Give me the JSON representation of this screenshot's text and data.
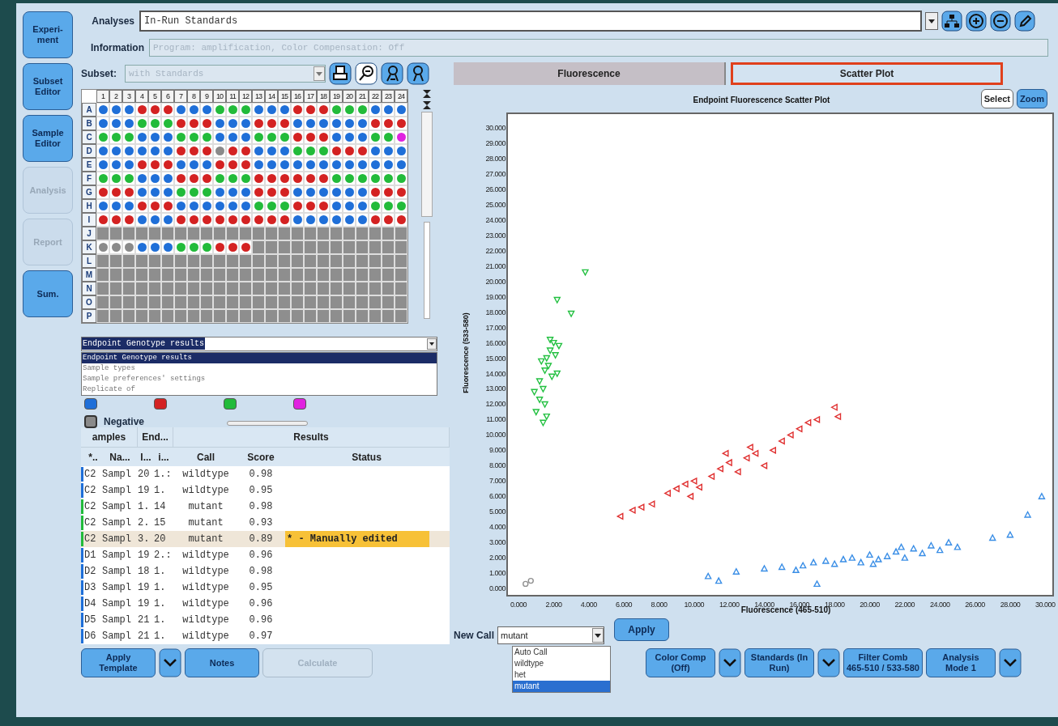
{
  "nav": [
    {
      "label": "Experi-\nment",
      "disabled": false
    },
    {
      "label": "Subset\nEditor",
      "disabled": false
    },
    {
      "label": "Sample\nEditor",
      "disabled": false
    },
    {
      "label": "Analysis",
      "disabled": true
    },
    {
      "label": "Report",
      "disabled": true
    },
    {
      "label": "Sum.",
      "disabled": false
    }
  ],
  "analyses": {
    "label": "Analyses",
    "value": "In-Run Standards"
  },
  "information": {
    "label": "Information",
    "value": "Program: amplification, Color Compensation: Off",
    "disabled": true
  },
  "subset": {
    "label": "Subset:",
    "value": "with Standards",
    "disabled": true
  },
  "plate": {
    "columns": [
      "1",
      "2",
      "3",
      "4",
      "5",
      "6",
      "7",
      "8",
      "9",
      "10",
      "11",
      "12",
      "13",
      "14",
      "15",
      "16",
      "17",
      "18",
      "19",
      "20",
      "21",
      "22",
      "23",
      "24"
    ],
    "rows": [
      {
        "label": "A",
        "wells": [
          {
            "color": "#1f6fd8"
          },
          {
            "color": "#1f6fd8"
          },
          {
            "color": "#1f6fd8"
          },
          {
            "color": "#d42222"
          },
          {
            "color": "#d42222"
          },
          {
            "color": "#d42222"
          },
          {
            "color": "#1f6fd8"
          },
          {
            "color": "#1f6fd8"
          },
          {
            "color": "#1f6fd8"
          },
          {
            "color": "#22bb3a"
          },
          {
            "color": "#22bb3a"
          },
          {
            "color": "#22bb3a"
          },
          {
            "color": "#1f6fd8"
          },
          {
            "color": "#1f6fd8"
          },
          {
            "color": "#1f6fd8"
          },
          {
            "color": "#d42222"
          },
          {
            "color": "#d42222"
          },
          {
            "color": "#d42222"
          },
          {
            "color": "#22bb3a"
          },
          {
            "color": "#22bb3a"
          },
          {
            "color": "#22bb3a"
          },
          {
            "color": "#1f6fd8"
          },
          {
            "color": "#1f6fd8"
          },
          {
            "color": "#1f6fd8"
          }
        ]
      },
      {
        "label": "B",
        "wells": [
          {
            "color": "#1f6fd8"
          },
          {
            "color": "#1f6fd8"
          },
          {
            "color": "#1f6fd8"
          },
          {
            "color": "#22bb3a"
          },
          {
            "color": "#22bb3a"
          },
          {
            "color": "#22bb3a"
          },
          {
            "color": "#d42222"
          },
          {
            "color": "#d42222"
          },
          {
            "color": "#d42222"
          },
          {
            "color": "#1f6fd8"
          },
          {
            "color": "#1f6fd8"
          },
          {
            "color": "#1f6fd8"
          },
          {
            "color": "#d42222"
          },
          {
            "color": "#d42222"
          },
          {
            "color": "#d42222"
          },
          {
            "color": "#1f6fd8"
          },
          {
            "color": "#1f6fd8"
          },
          {
            "color": "#1f6fd8"
          },
          {
            "color": "#1f6fd8"
          },
          {
            "color": "#1f6fd8"
          },
          {
            "color": "#1f6fd8"
          },
          {
            "color": "#d42222"
          },
          {
            "color": "#d42222"
          },
          {
            "color": "#d42222"
          }
        ]
      },
      {
        "label": "C",
        "wells": [
          {
            "color": "#22bb3a"
          },
          {
            "color": "#22bb3a"
          },
          {
            "color": "#22bb3a"
          },
          {
            "color": "#1f6fd8"
          },
          {
            "color": "#1f6fd8"
          },
          {
            "color": "#1f6fd8"
          },
          {
            "color": "#22bb3a"
          },
          {
            "color": "#22bb3a"
          },
          {
            "color": "#22bb3a"
          },
          {
            "color": "#1f6fd8"
          },
          {
            "color": "#1f6fd8"
          },
          {
            "color": "#1f6fd8"
          },
          {
            "color": "#22bb3a"
          },
          {
            "color": "#22bb3a"
          },
          {
            "color": "#22bb3a"
          },
          {
            "color": "#d42222"
          },
          {
            "color": "#d42222"
          },
          {
            "color": "#d42222"
          },
          {
            "color": "#1f6fd8"
          },
          {
            "color": "#1f6fd8"
          },
          {
            "color": "#1f6fd8"
          },
          {
            "color": "#22bb3a"
          },
          {
            "color": "#22bb3a"
          },
          {
            "color": "#e022e0"
          }
        ]
      },
      {
        "label": "D",
        "wells": [
          {
            "color": "#1f6fd8"
          },
          {
            "color": "#1f6fd8"
          },
          {
            "color": "#1f6fd8"
          },
          {
            "color": "#1f6fd8"
          },
          {
            "color": "#1f6fd8"
          },
          {
            "color": "#1f6fd8"
          },
          {
            "color": "#d42222"
          },
          {
            "color": "#d42222"
          },
          {
            "color": "#d42222"
          },
          {
            "color": "#8a8a8a"
          },
          {
            "color": "#d42222"
          },
          {
            "color": "#d42222"
          },
          {
            "color": "#1f6fd8"
          },
          {
            "color": "#1f6fd8"
          },
          {
            "color": "#1f6fd8"
          },
          {
            "color": "#22bb3a"
          },
          {
            "color": "#22bb3a"
          },
          {
            "color": "#22bb3a"
          },
          {
            "color": "#d42222"
          },
          {
            "color": "#d42222"
          },
          {
            "color": "#d42222"
          },
          {
            "color": "#1f6fd8"
          },
          {
            "color": "#1f6fd8"
          },
          {
            "color": "#1f6fd8"
          }
        ]
      },
      {
        "label": "E",
        "wells": [
          {
            "color": "#1f6fd8"
          },
          {
            "color": "#1f6fd8"
          },
          {
            "color": "#1f6fd8"
          },
          {
            "color": "#d42222"
          },
          {
            "color": "#d42222"
          },
          {
            "color": "#d42222"
          },
          {
            "color": "#1f6fd8"
          },
          {
            "color": "#1f6fd8"
          },
          {
            "color": "#1f6fd8"
          },
          {
            "color": "#d42222"
          },
          {
            "color": "#d42222"
          },
          {
            "color": "#d42222"
          },
          {
            "color": "#1f6fd8"
          },
          {
            "color": "#1f6fd8"
          },
          {
            "color": "#1f6fd8"
          },
          {
            "color": "#1f6fd8"
          },
          {
            "color": "#1f6fd8"
          },
          {
            "color": "#1f6fd8"
          },
          {
            "color": "#1f6fd8"
          },
          {
            "color": "#1f6fd8"
          },
          {
            "color": "#1f6fd8"
          },
          {
            "color": "#1f6fd8"
          },
          {
            "color": "#1f6fd8"
          },
          {
            "color": "#1f6fd8"
          }
        ]
      },
      {
        "label": "F",
        "wells": [
          {
            "color": "#22bb3a"
          },
          {
            "color": "#22bb3a"
          },
          {
            "color": "#22bb3a"
          },
          {
            "color": "#1f6fd8"
          },
          {
            "color": "#1f6fd8"
          },
          {
            "color": "#1f6fd8"
          },
          {
            "color": "#d42222"
          },
          {
            "color": "#d42222"
          },
          {
            "color": "#d42222"
          },
          {
            "color": "#22bb3a"
          },
          {
            "color": "#22bb3a"
          },
          {
            "color": "#22bb3a"
          },
          {
            "color": "#d42222"
          },
          {
            "color": "#d42222"
          },
          {
            "color": "#d42222"
          },
          {
            "color": "#d42222"
          },
          {
            "color": "#d42222"
          },
          {
            "color": "#d42222"
          },
          {
            "color": "#22bb3a"
          },
          {
            "color": "#22bb3a"
          },
          {
            "color": "#22bb3a"
          },
          {
            "color": "#22bb3a"
          },
          {
            "color": "#22bb3a"
          },
          {
            "color": "#22bb3a"
          }
        ]
      },
      {
        "label": "G",
        "wells": [
          {
            "color": "#d42222"
          },
          {
            "color": "#d42222"
          },
          {
            "color": "#d42222"
          },
          {
            "color": "#1f6fd8"
          },
          {
            "color": "#1f6fd8"
          },
          {
            "color": "#1f6fd8"
          },
          {
            "color": "#22bb3a"
          },
          {
            "color": "#22bb3a"
          },
          {
            "color": "#22bb3a"
          },
          {
            "color": "#1f6fd8"
          },
          {
            "color": "#1f6fd8"
          },
          {
            "color": "#1f6fd8"
          },
          {
            "color": "#d42222"
          },
          {
            "color": "#d42222"
          },
          {
            "color": "#d42222"
          },
          {
            "color": "#1f6fd8"
          },
          {
            "color": "#1f6fd8"
          },
          {
            "color": "#1f6fd8"
          },
          {
            "color": "#1f6fd8"
          },
          {
            "color": "#1f6fd8"
          },
          {
            "color": "#1f6fd8"
          },
          {
            "color": "#d42222"
          },
          {
            "color": "#d42222"
          },
          {
            "color": "#d42222"
          }
        ]
      },
      {
        "label": "H",
        "wells": [
          {
            "color": "#1f6fd8"
          },
          {
            "color": "#1f6fd8"
          },
          {
            "color": "#1f6fd8"
          },
          {
            "color": "#d42222"
          },
          {
            "color": "#d42222"
          },
          {
            "color": "#d42222"
          },
          {
            "color": "#1f6fd8"
          },
          {
            "color": "#1f6fd8"
          },
          {
            "color": "#1f6fd8"
          },
          {
            "color": "#1f6fd8"
          },
          {
            "color": "#1f6fd8"
          },
          {
            "color": "#1f6fd8"
          },
          {
            "color": "#22bb3a"
          },
          {
            "color": "#22bb3a"
          },
          {
            "color": "#22bb3a"
          },
          {
            "color": "#d42222"
          },
          {
            "color": "#d42222"
          },
          {
            "color": "#d42222"
          },
          {
            "color": "#1f6fd8"
          },
          {
            "color": "#1f6fd8"
          },
          {
            "color": "#1f6fd8"
          },
          {
            "color": "#22bb3a"
          },
          {
            "color": "#22bb3a"
          },
          {
            "color": "#22bb3a"
          }
        ]
      },
      {
        "label": "I",
        "wells": [
          {
            "color": "#d42222"
          },
          {
            "color": "#d42222"
          },
          {
            "color": "#d42222"
          },
          {
            "color": "#1f6fd8"
          },
          {
            "color": "#1f6fd8"
          },
          {
            "color": "#1f6fd8"
          },
          {
            "color": "#d42222"
          },
          {
            "color": "#d42222"
          },
          {
            "color": "#d42222"
          },
          {
            "color": "#d42222"
          },
          {
            "color": "#d42222"
          },
          {
            "color": "#d42222"
          },
          {
            "color": "#d42222"
          },
          {
            "color": "#d42222"
          },
          {
            "color": "#d42222"
          },
          {
            "color": "#1f6fd8"
          },
          {
            "color": "#1f6fd8"
          },
          {
            "color": "#1f6fd8"
          },
          {
            "color": "#1f6fd8"
          },
          {
            "color": "#1f6fd8"
          },
          {
            "color": "#1f6fd8"
          },
          {
            "color": "#d42222"
          },
          {
            "color": "#d42222"
          },
          {
            "color": "#d42222"
          }
        ]
      },
      {
        "label": "J"
      },
      {
        "label": "K",
        "wells": [
          {
            "color": "#8a8a8a"
          },
          {
            "color": "#8a8a8a"
          },
          {
            "color": "#8a8a8a"
          },
          {
            "color": "#1f6fd8"
          },
          {
            "color": "#1f6fd8"
          },
          {
            "color": "#1f6fd8"
          },
          {
            "color": "#22bb3a"
          },
          {
            "color": "#22bb3a"
          },
          {
            "color": "#22bb3a"
          },
          {
            "color": "#d42222"
          },
          {
            "color": "#d42222"
          },
          {
            "color": "#d42222"
          }
        ]
      },
      {
        "label": "L"
      },
      {
        "label": "M"
      },
      {
        "label": "N"
      },
      {
        "label": "O"
      },
      {
        "label": "P"
      }
    ]
  },
  "view_select": {
    "value": "Endpoint Genotype results",
    "options": [
      {
        "label": "Endpoint Genotype results",
        "selected": true
      },
      {
        "label": "Sample types",
        "selected": false
      },
      {
        "label": "Sample preferences' settings",
        "selected": false
      },
      {
        "label": "Replicate of",
        "selected": false
      }
    ]
  },
  "legend": [
    {
      "color": "#1f6fd8"
    },
    {
      "color": "#d42222"
    },
    {
      "color": "#22bb3a"
    },
    {
      "color": "#e022e0"
    },
    {
      "color": "#8a8a8a",
      "label": "Negative"
    }
  ],
  "table": {
    "groups": [
      "amples",
      "End...",
      "Results"
    ],
    "columns": [
      "*..",
      "Na...",
      "I...",
      "i...",
      "Call",
      "Score",
      "Status"
    ],
    "rows": [
      {
        "color": "#1f6fd8",
        "selected": false,
        "cells": [
          "C2",
          "Sampl",
          "20",
          "1.:",
          "wildtype",
          "0.98",
          ""
        ]
      },
      {
        "color": "#1f6fd8",
        "selected": false,
        "cells": [
          "C2",
          "Sampl",
          "19",
          "1.",
          "wildtype",
          "0.95",
          ""
        ]
      },
      {
        "color": "#22bb3a",
        "selected": false,
        "cells": [
          "C2",
          "Sampl",
          "1.",
          "14",
          "mutant",
          "0.98",
          ""
        ]
      },
      {
        "color": "#22bb3a",
        "selected": false,
        "cells": [
          "C2",
          "Sampl",
          "2.",
          "15",
          "mutant",
          "0.93",
          ""
        ]
      },
      {
        "color": "#22bb3a",
        "selected": true,
        "cells": [
          "C2",
          "Sampl",
          "3.",
          "20",
          "mutant",
          "0.89",
          "* - Manually edited"
        ]
      },
      {
        "color": "#1f6fd8",
        "selected": false,
        "cells": [
          "D1",
          "Sampl",
          "19",
          "2.:",
          "wildtype",
          "0.96",
          ""
        ]
      },
      {
        "color": "#1f6fd8",
        "selected": false,
        "cells": [
          "D2",
          "Sampl",
          "18",
          "1.",
          "wildtype",
          "0.98",
          ""
        ]
      },
      {
        "color": "#1f6fd8",
        "selected": false,
        "cells": [
          "D3",
          "Sampl",
          "19",
          "1.",
          "wildtype",
          "0.95",
          ""
        ]
      },
      {
        "color": "#1f6fd8",
        "selected": false,
        "cells": [
          "D4",
          "Sampl",
          "19",
          "1.",
          "wildtype",
          "0.96",
          ""
        ]
      },
      {
        "color": "#1f6fd8",
        "selected": false,
        "cells": [
          "D5",
          "Sampl",
          "21",
          "1.",
          "wildtype",
          "0.96",
          ""
        ]
      },
      {
        "color": "#1f6fd8",
        "selected": false,
        "cells": [
          "D6",
          "Sampl",
          "21",
          "1.",
          "wildtype",
          "0.97",
          ""
        ]
      }
    ]
  },
  "tabs": [
    {
      "label": "Fluorescence",
      "selected": false
    },
    {
      "label": "Scatter Plot",
      "selected": true
    }
  ],
  "plot_buttons": [
    {
      "label": "Select",
      "selected": false
    },
    {
      "label": "Zoom",
      "selected": true
    }
  ],
  "chart_data": {
    "type": "scatter",
    "title": "Endpoint Fluorescence Scatter Plot",
    "xlabel": "Fluorescence (465-510)",
    "ylabel": "Fluorescence (533-580)",
    "xlim": [
      -0.65,
      30.45
    ],
    "ylim": [
      -0.47,
      30.95
    ],
    "xticks": [
      {
        "value": 0,
        "label": "0.000"
      },
      {
        "value": 2,
        "label": "2.000"
      },
      {
        "value": 4,
        "label": "4.000"
      },
      {
        "value": 6,
        "label": "6.000"
      },
      {
        "value": 8,
        "label": "8.000"
      },
      {
        "value": 10,
        "label": "10.000"
      },
      {
        "value": 12,
        "label": "12.000"
      },
      {
        "value": 14,
        "label": "14.000"
      },
      {
        "value": 16,
        "label": "16.000"
      },
      {
        "value": 18,
        "label": "18.000"
      },
      {
        "value": 20,
        "label": "20.000"
      },
      {
        "value": 22,
        "label": "22.000"
      },
      {
        "value": 24,
        "label": "24.000"
      },
      {
        "value": 26,
        "label": "26.000"
      },
      {
        "value": 28,
        "label": "28.000"
      },
      {
        "value": 30,
        "label": "30.000"
      }
    ],
    "yticks": [
      {
        "value": 0,
        "label": "0.000"
      },
      {
        "value": 1,
        "label": "1.000"
      },
      {
        "value": 2,
        "label": "2.000"
      },
      {
        "value": 3,
        "label": "3.000"
      },
      {
        "value": 4,
        "label": "4.000"
      },
      {
        "value": 5,
        "label": "5.000"
      },
      {
        "value": 6,
        "label": "6.000"
      },
      {
        "value": 7,
        "label": "7.000"
      },
      {
        "value": 8,
        "label": "8.000"
      },
      {
        "value": 9,
        "label": "9.000"
      },
      {
        "value": 10,
        "label": "10.000"
      },
      {
        "value": 11,
        "label": "11.000"
      },
      {
        "value": 12,
        "label": "12.000"
      },
      {
        "value": 13,
        "label": "13.000"
      },
      {
        "value": 14,
        "label": "14.000"
      },
      {
        "value": 15,
        "label": "15.000"
      },
      {
        "value": 16,
        "label": "16.000"
      },
      {
        "value": 17,
        "label": "17.000"
      },
      {
        "value": 18,
        "label": "18.000"
      },
      {
        "value": 19,
        "label": "19.000"
      },
      {
        "value": 20,
        "label": "20.000"
      },
      {
        "value": 21,
        "label": "21.000"
      },
      {
        "value": 22,
        "label": "22.000"
      },
      {
        "value": 23,
        "label": "23.000"
      },
      {
        "value": 24,
        "label": "24.000"
      },
      {
        "value": 25,
        "label": "25.000"
      },
      {
        "value": 26,
        "label": "26.000"
      },
      {
        "value": 27,
        "label": "27.000"
      },
      {
        "value": 28,
        "label": "28.000"
      },
      {
        "value": 29,
        "label": "29.000"
      },
      {
        "value": 30,
        "label": "30.000"
      }
    ],
    "series": [
      {
        "color": "#22c040",
        "marker": "triangle",
        "x": [
          1.0,
          1.2,
          1.4,
          1.5,
          1.6,
          1.8,
          2.0,
          1.3,
          1.7,
          1.9,
          2.1,
          1.5,
          1.2,
          2.3,
          1.6,
          0.9,
          2.2,
          1.8,
          2.2,
          3.0,
          3.8,
          1.4
        ],
        "values": [
          11.5,
          12.3,
          13.0,
          14.2,
          15.0,
          15.5,
          16.0,
          14.8,
          14.5,
          13.8,
          15.2,
          12.0,
          13.5,
          15.8,
          11.2,
          12.8,
          14.0,
          16.2,
          18.8,
          17.9,
          20.6,
          10.8
        ]
      },
      {
        "color": "#e03030",
        "marker": "triangle",
        "x": [
          5.8,
          6.5,
          7.0,
          7.6,
          8.5,
          9.0,
          9.5,
          10.0,
          10.3,
          11.0,
          11.5,
          12.0,
          12.5,
          13.0,
          13.5,
          14.0,
          14.5,
          15.0,
          15.5,
          16.0,
          16.5,
          17.0,
          18.0,
          18.2,
          9.8,
          11.8,
          13.2
        ],
        "values": [
          4.7,
          5.1,
          5.3,
          5.5,
          6.2,
          6.5,
          6.8,
          7.0,
          6.6,
          7.3,
          7.8,
          8.2,
          7.6,
          8.5,
          8.8,
          8.0,
          9.0,
          9.6,
          10.0,
          10.4,
          10.8,
          11.0,
          11.8,
          11.2,
          6.0,
          8.8,
          9.2
        ]
      },
      {
        "color": "#3a8ee6",
        "marker": "triangle",
        "x": [
          10.8,
          11.4,
          12.4,
          14.0,
          15.0,
          15.8,
          16.2,
          16.8,
          17.0,
          17.5,
          18.0,
          18.5,
          19.0,
          19.5,
          20.0,
          20.5,
          21.0,
          21.5,
          22.0,
          22.5,
          23.0,
          23.5,
          24.0,
          24.5,
          25.0,
          27.0,
          28.0,
          29.0,
          29.8,
          20.2,
          21.8
        ],
        "values": [
          0.8,
          0.5,
          1.1,
          1.3,
          1.4,
          1.2,
          1.5,
          1.7,
          0.3,
          1.8,
          1.6,
          1.9,
          2.0,
          1.7,
          2.2,
          1.9,
          2.1,
          2.4,
          2.0,
          2.6,
          2.3,
          2.8,
          2.5,
          3.0,
          2.7,
          3.3,
          3.5,
          4.8,
          6.0,
          1.6,
          2.7
        ]
      },
      {
        "color": "#909090",
        "marker": "circle",
        "x": [
          0.4,
          0.7
        ],
        "values": [
          0.3,
          0.5
        ]
      }
    ]
  },
  "point_markers": [
    {
      "kind": "down"
    },
    {
      "kind": "left"
    },
    {
      "kind": "up"
    }
  ],
  "new_call": {
    "label": "New Call",
    "value": "mutant",
    "options": [
      {
        "label": "Auto Call",
        "selected": false
      },
      {
        "label": "wildtype",
        "selected": false
      },
      {
        "label": "het",
        "selected": false
      },
      {
        "label": "mutant",
        "selected": true
      }
    ],
    "apply": "Apply"
  },
  "bottom_left": [
    {
      "label": "Apply\nTemplate",
      "disabled": false,
      "menu": true
    },
    {
      "label": "Notes",
      "disabled": false,
      "menu": false
    },
    {
      "label": "Calculate",
      "disabled": true,
      "menu": false
    }
  ],
  "bottom_right": [
    {
      "label": "Color Comp\n(Off)",
      "menu": true
    },
    {
      "label": "Standards (In\nRun)",
      "menu": true
    },
    {
      "label": "Filter Comb\n465-510 / 533-580",
      "menu": false
    },
    {
      "label": "Analysis\nMode 1",
      "menu": true
    }
  ]
}
